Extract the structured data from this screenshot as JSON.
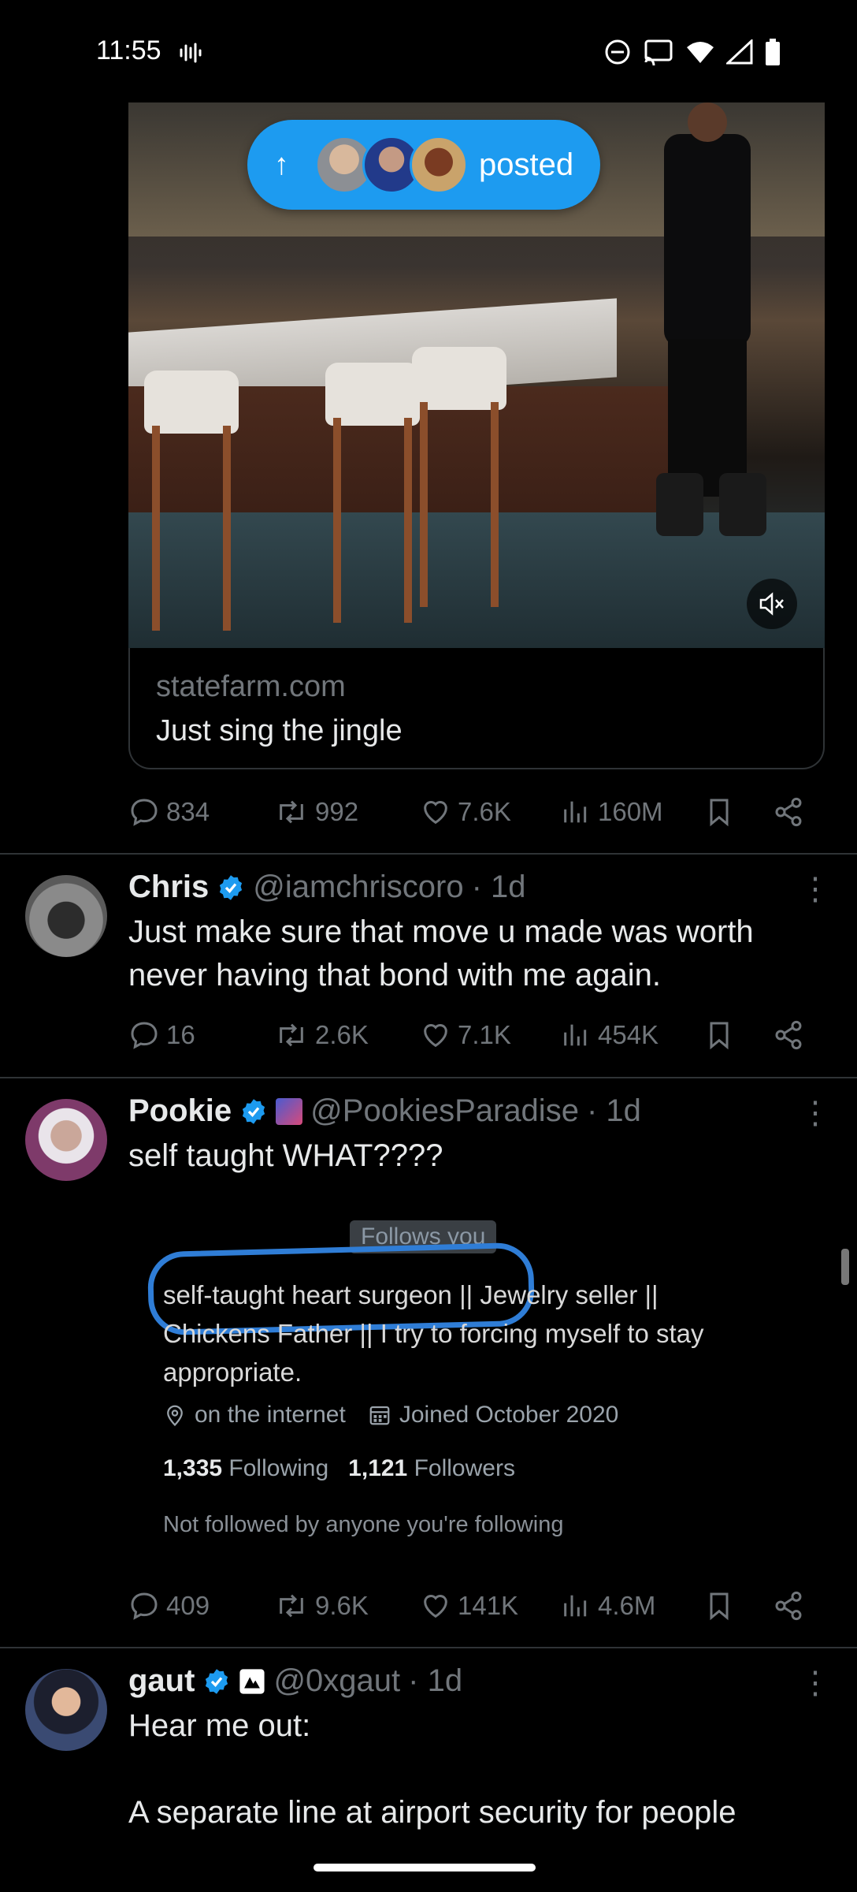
{
  "status_bar": {
    "time": "11:55"
  },
  "top_post": {
    "pill_label": "posted",
    "card_domain": "statefarm.com",
    "card_title": "Just sing the jingle",
    "actions": {
      "replies": "834",
      "reposts": "992",
      "likes": "7.6K",
      "views": "160M"
    }
  },
  "tweets": [
    {
      "name": "Chris",
      "handle": "@iamchriscoro",
      "time": "· 1d",
      "text_lines": [
        "Just make sure that move u made was worth",
        "never having that bond with me again."
      ],
      "actions": {
        "replies": "16",
        "reposts": "2.6K",
        "likes": "7.1K",
        "views": "454K"
      }
    },
    {
      "name": "Pookie",
      "handle": "@PookiesParadise",
      "time": "· 1d",
      "text": "self taught WHAT????",
      "screenshot": {
        "follows_badge": "Follows you",
        "bio_line1_circled": "self-taught heart surgeon ||",
        "bio_line1_rest": " Jewelry seller ||",
        "bio_line2": "Chickens Father || I try to forcing myself to stay",
        "bio_line3": "appropriate.",
        "location": "on the internet",
        "joined": "Joined October 2020",
        "following_count": "1,335",
        "following_label": "Following",
        "followers_count": "1,121",
        "followers_label": "Followers",
        "not_followed": "Not followed by anyone you're following"
      },
      "actions": {
        "replies": "409",
        "reposts": "9.6K",
        "likes": "141K",
        "views": "4.6M"
      }
    },
    {
      "name": "gaut",
      "handle": "@0xgaut",
      "time": "· 1d",
      "text_line1": "Hear me out:",
      "text_line2": "A separate line at airport security for people"
    }
  ],
  "colors": {
    "accent": "#1d9bf0",
    "muted": "#71767b",
    "divider": "#2f3336",
    "text": "#e7e9ea"
  }
}
